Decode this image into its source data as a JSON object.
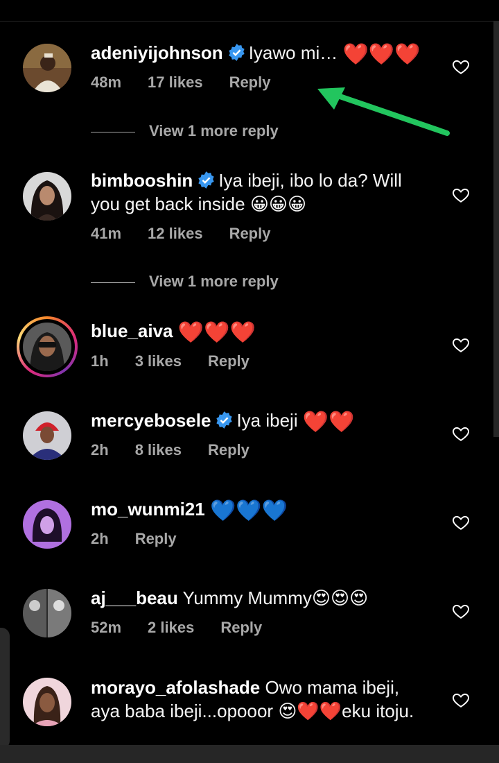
{
  "comments": [
    {
      "username": "adeniyijohnson",
      "verified": true,
      "text": "Iyawo mi… ",
      "emojis": "❤️❤️❤️",
      "time": "48m",
      "likes": "17 likes",
      "reply": "Reply",
      "view_more": "View 1 more reply",
      "avatar_color": "#7a5a3a"
    },
    {
      "username": "bimbooshin",
      "verified": true,
      "text": "Iya ibeji, ibo lo da? Will you get back inside ",
      "emojis": "😀😀😀",
      "time": "41m",
      "likes": "12 likes",
      "reply": "Reply",
      "view_more": "View 1 more reply",
      "avatar_color": "#3a2a24"
    },
    {
      "username": "blue_aiva",
      "verified": false,
      "text": " ",
      "emojis": "❤️❤️❤️",
      "time": "1h",
      "likes": "3 likes",
      "reply": "Reply",
      "story_ring": true,
      "avatar_color": "#4a4a4a"
    },
    {
      "username": "mercyebosele",
      "verified": true,
      "text": "Iya ibeji ",
      "emojis": "❤️❤️",
      "time": "2h",
      "likes": "8 likes",
      "reply": "Reply",
      "avatar_color": "#3a3f8a"
    },
    {
      "username": "mo_wunmi21",
      "verified": false,
      "text": " ",
      "emojis": "💙💙💙",
      "time": "2h",
      "reply": "Reply",
      "avatar_color": "#b070e0"
    },
    {
      "username": "aj___beau",
      "verified": false,
      "text": "Yummy Mummy",
      "emojis": "😍😍😍",
      "time": "52m",
      "likes": "2 likes",
      "reply": "Reply",
      "avatar_color": "#6a6a6a"
    },
    {
      "username": "morayo_afolashade",
      "verified": false,
      "text": "Owo mama ibeji, aya baba ibeji...opooor ",
      "emojis": "😍❤️❤️",
      "text_after": "eku itoju.",
      "avatar_color": "#e8b4c4"
    }
  ],
  "colors": {
    "background": "#000000",
    "meta": "#a8a8a8",
    "verified": "#3897f0",
    "arrow": "#22c55e",
    "heart_red": "#e0243a",
    "heart_blue": "#1e90ff"
  }
}
